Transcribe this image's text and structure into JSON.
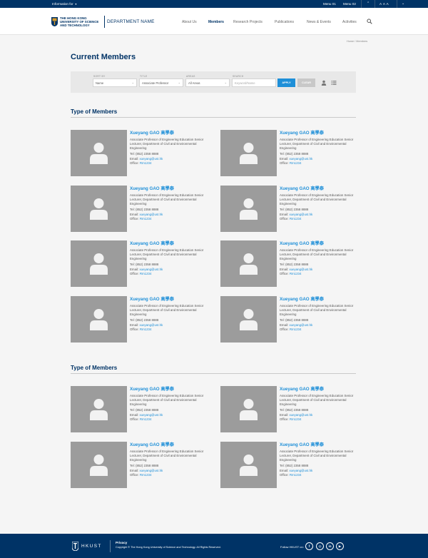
{
  "top_bar": {
    "info_label": "Information for",
    "menu1": "Menu 01",
    "menu2": "Menu 02",
    "font_size_label": "A A A"
  },
  "header": {
    "university_lines": [
      "The Hong Kong",
      "University of Science",
      "and Technology"
    ],
    "department": "DEPARTMENT NAME",
    "nav": [
      "About Us",
      "Members",
      "Research Projects",
      "Publications",
      "News & Events",
      "Activities"
    ],
    "active_nav": "Members"
  },
  "breadcrumb": "Home  /  Members",
  "page_title": "Current Members",
  "filters": {
    "sort_by": {
      "label": "Sort by",
      "value": "Name"
    },
    "title": {
      "label": "Title",
      "value": "Associate Professor"
    },
    "areas": {
      "label": "Areas",
      "value": "All Areas"
    },
    "search": {
      "label": "Search",
      "placeholder": "Keyword/Name"
    },
    "apply": "APPLY",
    "clear": "CLEAR"
  },
  "member": {
    "name": "Xueyang GAO 高學泰",
    "title": "Associate Professor of Engineering Education Senior Lecturer, Department of Civil and Environmental Engineering",
    "tel_label": "Tel:",
    "tel": "(852) 2358 8888",
    "email_label": "Email:",
    "email": "xueyang@ust.hk",
    "office_label": "Office:",
    "office": "Rm1234"
  },
  "sections": [
    {
      "title": "Type of Members",
      "count": 8
    },
    {
      "title": "Type of Members",
      "count": 4
    }
  ],
  "footer": {
    "logo": "HKUST",
    "privacy": "Privacy",
    "copyright": "Copyright © The Hong Kong University of Science and Technology. All Rights Reserved.",
    "follow": "Follow HKUST on:",
    "social": [
      "facebook-icon",
      "instagram-icon",
      "linkedin-icon",
      "youtube-icon"
    ]
  },
  "colors": {
    "navy": "#003366",
    "accent": "#1e8fd8",
    "photo_placeholder": "#9c9c9c"
  }
}
